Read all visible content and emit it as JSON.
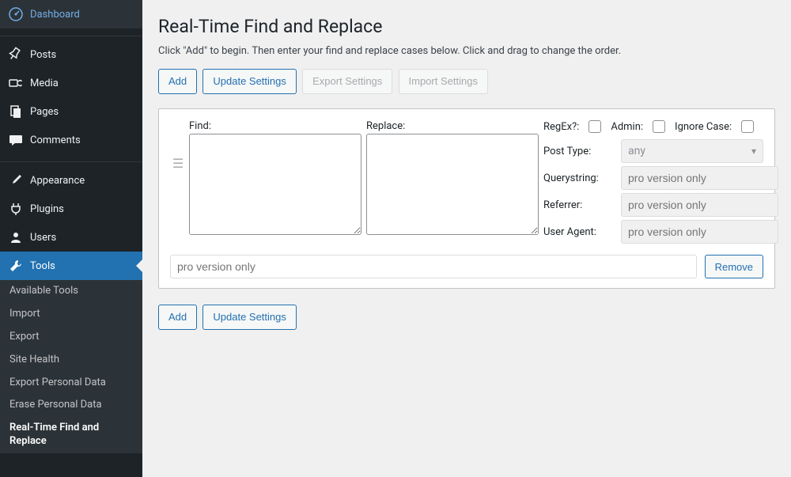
{
  "sidebar": {
    "items": [
      {
        "label": "Dashboard",
        "icon": "dashboard-icon"
      },
      {
        "label": "Posts",
        "icon": "pin-icon"
      },
      {
        "label": "Media",
        "icon": "media-icon"
      },
      {
        "label": "Pages",
        "icon": "pages-icon"
      },
      {
        "label": "Comments",
        "icon": "comments-icon"
      },
      {
        "label": "Appearance",
        "icon": "brush-icon"
      },
      {
        "label": "Plugins",
        "icon": "plug-icon"
      },
      {
        "label": "Users",
        "icon": "users-icon"
      },
      {
        "label": "Tools",
        "icon": "wrench-icon"
      }
    ],
    "submenu": [
      {
        "label": "Available Tools"
      },
      {
        "label": "Import"
      },
      {
        "label": "Export"
      },
      {
        "label": "Site Health"
      },
      {
        "label": "Export Personal Data"
      },
      {
        "label": "Erase Personal Data"
      },
      {
        "label": "Real-Time Find and Replace"
      }
    ]
  },
  "page": {
    "title": "Real-Time Find and Replace",
    "intro": "Click \"Add\" to begin. Then enter your find and replace cases below. Click and drag to change the order."
  },
  "buttons": {
    "add": "Add",
    "update": "Update Settings",
    "export": "Export Settings",
    "import": "Import Settings",
    "remove": "Remove"
  },
  "case": {
    "find_label": "Find:",
    "replace_label": "Replace:",
    "regex_label": "RegEx?:",
    "admin_label": "Admin:",
    "ignorecase_label": "Ignore Case:",
    "posttype_label": "Post Type:",
    "posttype_value": "any",
    "querystring_label": "Querystring:",
    "referrer_label": "Referrer:",
    "useragent_label": "User Agent:",
    "pro_placeholder": "pro version only"
  }
}
